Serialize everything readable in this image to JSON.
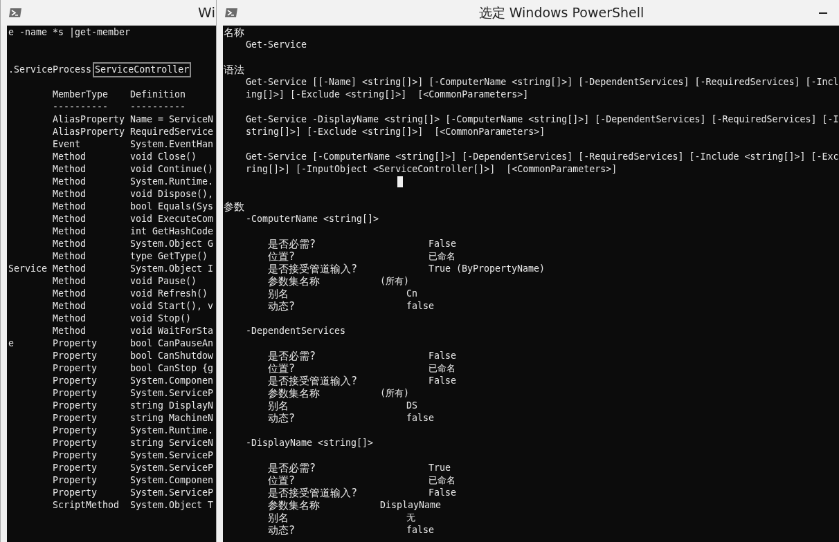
{
  "left_window": {
    "title": "Wi",
    "command": "e -name *s |get-member",
    "type_name_prefix": ".ServiceProcess",
    "selected_text": "ServiceController",
    "columns": [
      "MemberType",
      "Definition"
    ],
    "dashes": [
      "----------",
      "----------"
    ],
    "members": [
      {
        "type": "AliasProperty",
        "definition": "Name = ServiceN"
      },
      {
        "type": "AliasProperty",
        "definition": "RequiredService"
      },
      {
        "type": "Event",
        "definition": "System.EventHan"
      },
      {
        "type": "Method",
        "definition": "void Close()"
      },
      {
        "type": "Method",
        "definition": "void Continue()"
      },
      {
        "type": "Method",
        "definition": "System.Runtime."
      },
      {
        "type": "Method",
        "definition": "void Dispose(),"
      },
      {
        "type": "Method",
        "definition": "bool Equals(Sys"
      },
      {
        "type": "Method",
        "definition": "void ExecuteCom"
      },
      {
        "type": "Method",
        "definition": "int GetHashCode"
      },
      {
        "type": "Method",
        "definition": "System.Object G"
      },
      {
        "type": "Method",
        "definition": "type GetType()"
      },
      {
        "name": "Service",
        "type": "Method",
        "definition": "System.Object I"
      },
      {
        "type": "Method",
        "definition": "void Pause()"
      },
      {
        "type": "Method",
        "definition": "void Refresh()"
      },
      {
        "type": "Method",
        "definition": "void Start(), v"
      },
      {
        "type": "Method",
        "definition": "void Stop()"
      },
      {
        "type": "Method",
        "definition": "void WaitForSta"
      },
      {
        "name": "e",
        "type": "Property",
        "definition": "bool CanPauseAn"
      },
      {
        "type": "Property",
        "definition": "bool CanShutdow"
      },
      {
        "type": "Property",
        "definition": "bool CanStop {g"
      },
      {
        "type": "Property",
        "definition": "System.Componen"
      },
      {
        "type": "Property",
        "definition": "System.ServiceP"
      },
      {
        "type": "Property",
        "definition": "string DisplayN"
      },
      {
        "type": "Property",
        "definition": "string MachineN"
      },
      {
        "type": "Property",
        "definition": "System.Runtime."
      },
      {
        "type": "Property",
        "definition": "string ServiceN"
      },
      {
        "type": "Property",
        "definition": "System.ServiceP"
      },
      {
        "type": "Property",
        "definition": "System.ServiceP"
      },
      {
        "type": "Property",
        "definition": "System.Componen"
      },
      {
        "type": "Property",
        "definition": "System.ServiceP"
      },
      {
        "type": "ScriptMethod",
        "definition": "System.Object T"
      }
    ]
  },
  "right_window": {
    "title": "选定 Windows PowerShell",
    "name_section": {
      "heading": "名称",
      "value": "Get-Service"
    },
    "syntax_section": {
      "heading": "语法",
      "syntaxes": [
        [
          "Get-Service [[-Name] <string[]>] [-ComputerName <string[]>] [-DependentServices] [-RequiredServices] [-Incl",
          "ing[]>] [-Exclude <string[]>]  [<CommonParameters>]"
        ],
        [
          "Get-Service -DisplayName <string[]> [-ComputerName <string[]>] [-DependentServices] [-RequiredServices] [-I",
          "string[]>] [-Exclude <string[]>]  [<CommonParameters>]"
        ],
        [
          "Get-Service [-ComputerName <string[]>] [-DependentServices] [-RequiredServices] [-Include <string[]>] [-Exc",
          "ring[]>] [-InputObject <ServiceController[]>]  [<CommonParameters>]"
        ]
      ]
    },
    "parameters_section": {
      "heading": "参数",
      "parameters": [
        {
          "name": "-ComputerName <string[]>",
          "attributes": [
            {
              "label": "是否必需?",
              "value": "False"
            },
            {
              "label": "位置?",
              "value": "已命名"
            },
            {
              "label": "是否接受管道输入?",
              "value": "True (ByPropertyName)"
            },
            {
              "label": "参数集名称",
              "value": "(所有)"
            },
            {
              "label": "别名",
              "value": "Cn"
            },
            {
              "label": "动态?",
              "value": "false"
            }
          ]
        },
        {
          "name": "-DependentServices",
          "attributes": [
            {
              "label": "是否必需?",
              "value": "False"
            },
            {
              "label": "位置?",
              "value": "已命名"
            },
            {
              "label": "是否接受管道输入?",
              "value": "False"
            },
            {
              "label": "参数集名称",
              "value": "(所有)"
            },
            {
              "label": "别名",
              "value": "DS"
            },
            {
              "label": "动态?",
              "value": "false"
            }
          ]
        },
        {
          "name": "-DisplayName <string[]>",
          "attributes": [
            {
              "label": "是否必需?",
              "value": "True"
            },
            {
              "label": "位置?",
              "value": "已命名"
            },
            {
              "label": "是否接受管道输入?",
              "value": "False"
            },
            {
              "label": "参数集名称",
              "value": "DisplayName"
            },
            {
              "label": "别名",
              "value": "无"
            },
            {
              "label": "动态?",
              "value": "false"
            }
          ]
        }
      ]
    }
  }
}
